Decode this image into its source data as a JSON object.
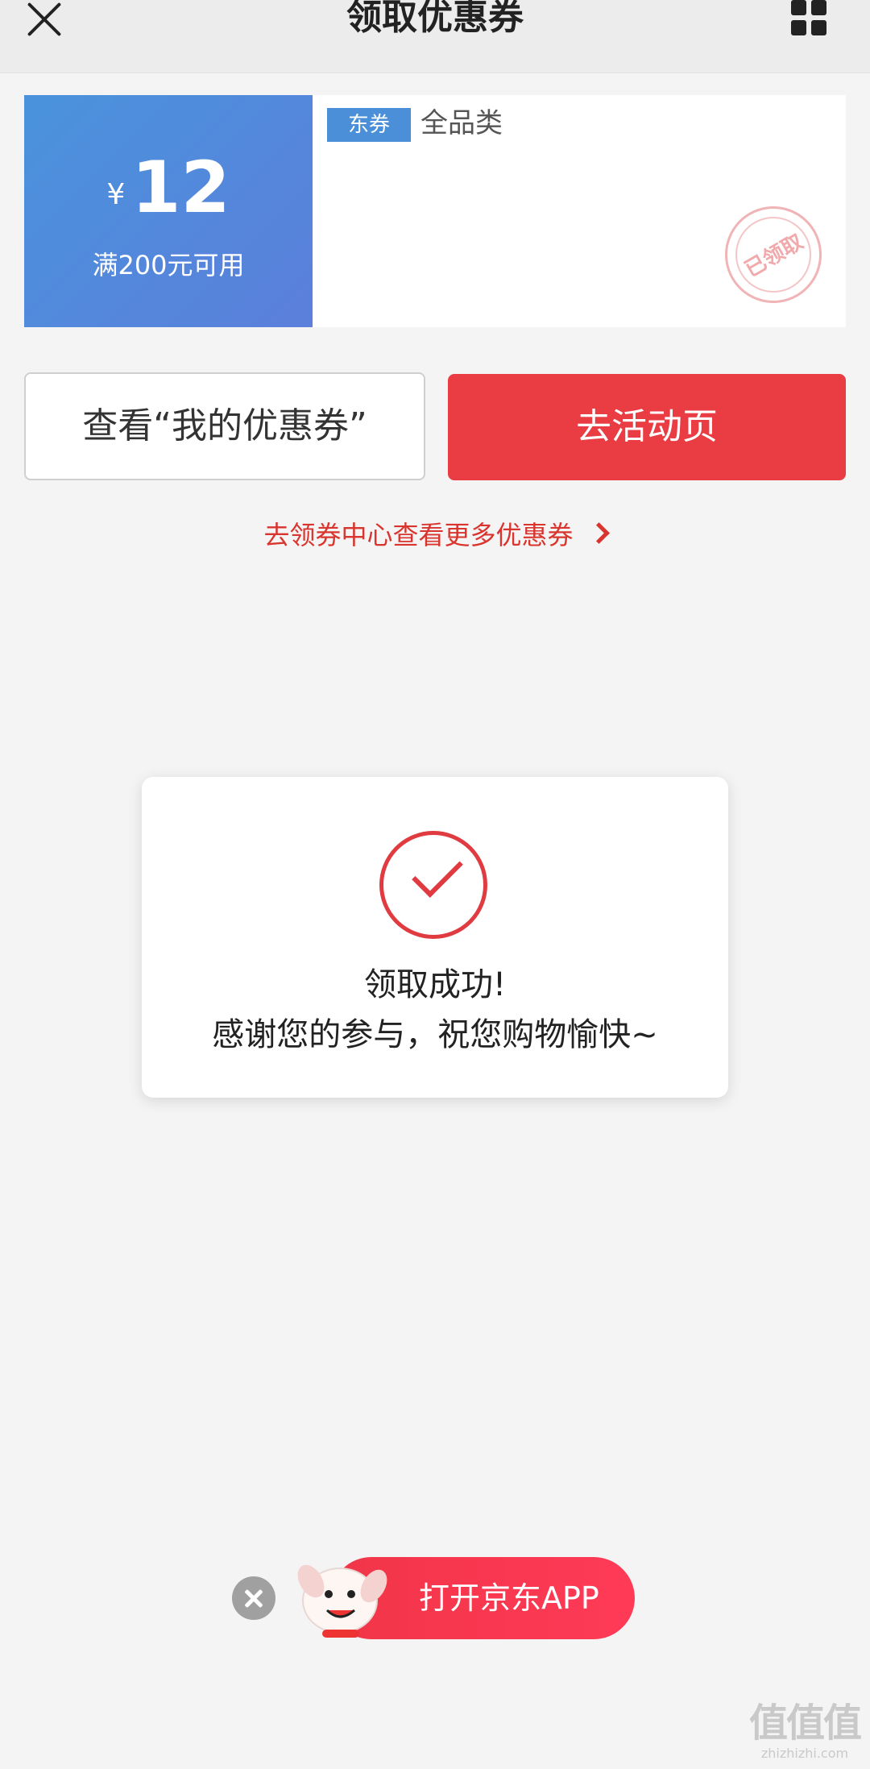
{
  "header": {
    "title": "领取优惠券",
    "close_icon": "close-icon",
    "menu_icon": "grid-menu-icon"
  },
  "coupon": {
    "currency": "¥",
    "amount": "12",
    "condition": "满200元可用",
    "tag": "东券",
    "scope": "全品类",
    "stamp_text": "已领取",
    "left_color": "#4a93dc"
  },
  "actions": {
    "my_coupons": "查看“我的优惠券”",
    "go_activity": "去活动页",
    "more_link": "去领券中心查看更多优惠券"
  },
  "modal": {
    "icon": "check-circle-icon",
    "title": "领取成功!",
    "message": "感谢您的参与，祝您购物愉快~"
  },
  "app_banner": {
    "label": "打开京东APP",
    "mascot_icon": "joy-dog-mascot-icon",
    "close_icon": "close-icon"
  },
  "watermark": {
    "glyphs": "值值值",
    "url": "zhizhizhi.com"
  },
  "colors": {
    "accent_red": "#e93c43",
    "coupon_blue": "#4a93dc",
    "link_red": "#d9352e"
  }
}
